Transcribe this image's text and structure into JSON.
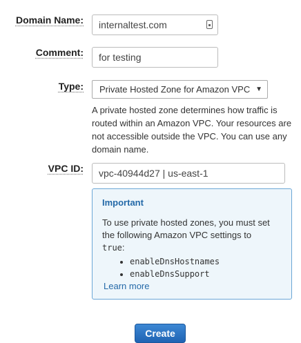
{
  "form": {
    "domain_name": {
      "label": "Domain Name:",
      "value": "internaltest.com"
    },
    "comment": {
      "label": "Comment:",
      "value": "for testing"
    },
    "type": {
      "label": "Type:",
      "selected": "Private Hosted Zone for Amazon VPC",
      "help": "A private hosted zone determines how traffic is routed within an Amazon VPC. Your resources are not accessible outside the VPC. You can use any domain name."
    },
    "vpc_id": {
      "label": "VPC ID:",
      "value": "vpc-40944d27 | us-east-1"
    }
  },
  "info_box": {
    "title": "Important",
    "text": "To use private hosted zones, you must set the following Amazon VPC settings to",
    "code_value": "true",
    "colon": ":",
    "settings": [
      "enableDnsHostnames",
      "enableDnsSupport"
    ],
    "link": "Learn more"
  },
  "create_button": "Create",
  "colors": {
    "accent": "#2469a8",
    "button": "#2a73c2",
    "info_bg": "#eef6fb",
    "info_border": "#6aa6d6"
  },
  "icons": {
    "caret": "chevron-down-icon",
    "field": "keypad-icon"
  }
}
